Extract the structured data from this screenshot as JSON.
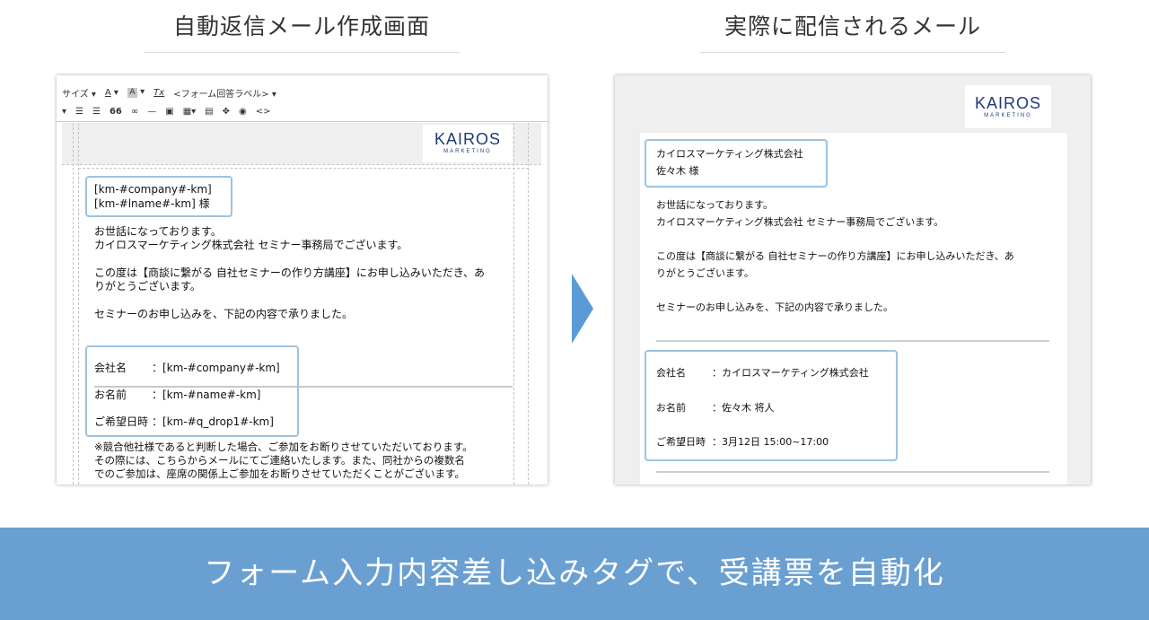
{
  "headings": {
    "left": "自動返信メール作成画面",
    "right": "実際に配信されるメール"
  },
  "toolbar": {
    "size_label": "サイズ",
    "font_color_label": "A",
    "bg_color_label": "A",
    "clear_format_label": "Tx",
    "form_label": "<フォーム回答ラベル>",
    "quote_label": "66",
    "hr_label": "—",
    "source_label": "<>"
  },
  "logo": {
    "main": "KAIROS",
    "sub": "MARKETING"
  },
  "editor": {
    "company_tag": "[km-#company#-km]",
    "name_tag": "[km-#lname#-km] 様",
    "greeting_line1": "お世話になっております。",
    "greeting_line2": "カイロスマーケティング株式会社 セミナー事務局でございます。",
    "body_line1": "この度は【商談に繋がる 自社セミナーの作り方講座】にお申し込みいただき、あ",
    "body_line2": "りがとうございます。",
    "accept_line": "セミナーのお申し込みを、下記の内容で承りました。",
    "fields": [
      {
        "label": "会社名",
        "value": "：[km-#company#-km]"
      },
      {
        "label": "お名前",
        "value": "：[km-#name#-km]"
      },
      {
        "label": "ご希望日時",
        "value": "：[km-#q_drop1#-km]"
      }
    ],
    "note_line1": "※競合他社様であると判断した場合、ご参加をお断りさせていただいております。",
    "note_line2": "その際には、こちらからメールにてご連絡いたします。また、同社からの複数名",
    "note_line3": "でのご参加は、座席の関係上ご参加をお断りさせていただくことがございます。"
  },
  "mail": {
    "company": "カイロスマーケティング株式会社",
    "name": "佐々木 様",
    "greeting_line1": "お世話になっております。",
    "greeting_line2": "カイロスマーケティング株式会社 セミナー事務局でございます。",
    "body_line1": "この度は【商談に繋がる 自社セミナーの作り方講座】にお申し込みいただき、あ",
    "body_line2": "りがとうございます。",
    "accept_line": "セミナーのお申し込みを、下記の内容で承りました。",
    "fields": [
      {
        "label": "会社名",
        "value": "：カイロスマーケティング株式会社"
      },
      {
        "label": "お名前",
        "value": "：佐々木 将人"
      },
      {
        "label": "ご希望日時",
        "value": "：3月12日 15:00~17:00"
      }
    ]
  },
  "banner": {
    "text": "フォーム入力内容差し込みタグで、受講票を自動化"
  },
  "colors": {
    "accent": "#6a9fd2",
    "arrow": "#5b9bd5",
    "highlight_border": "#9cc3e0",
    "logo": "#1e3a7a"
  }
}
